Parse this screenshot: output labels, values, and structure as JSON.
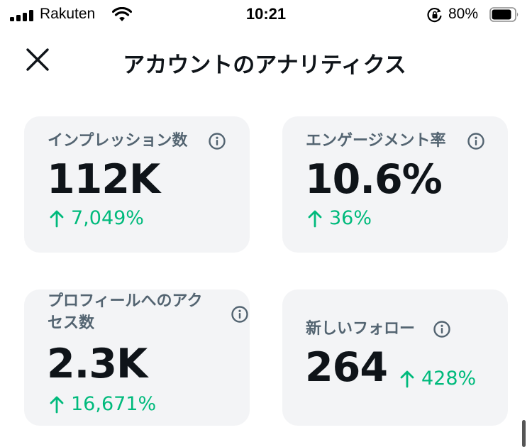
{
  "status_bar": {
    "carrier": "Rakuten",
    "time": "10:21",
    "battery_percent": "80%"
  },
  "header": {
    "title": "アカウントのアナリティクス",
    "close_icon": "close-icon"
  },
  "metrics": [
    {
      "label": "インプレッション数",
      "value": "112K",
      "delta": "7,049%",
      "trend": "up",
      "icon": "info-icon"
    },
    {
      "label": "エンゲージメント率",
      "value": "10.6%",
      "delta": "36%",
      "trend": "up",
      "icon": "info-icon"
    },
    {
      "label_line1": "プロフィールへのアク",
      "label_line2": "セス数",
      "value": "2.3K",
      "delta": "16,671%",
      "trend": "up",
      "icon": "info-icon"
    },
    {
      "label": "新しいフォロー",
      "value": "264",
      "delta": "428%",
      "trend": "up",
      "icon": "info-icon"
    }
  ],
  "colors": {
    "positive": "#00ba7c",
    "label": "#536471",
    "card_bg": "#f3f4f6",
    "text": "#0f1419"
  }
}
